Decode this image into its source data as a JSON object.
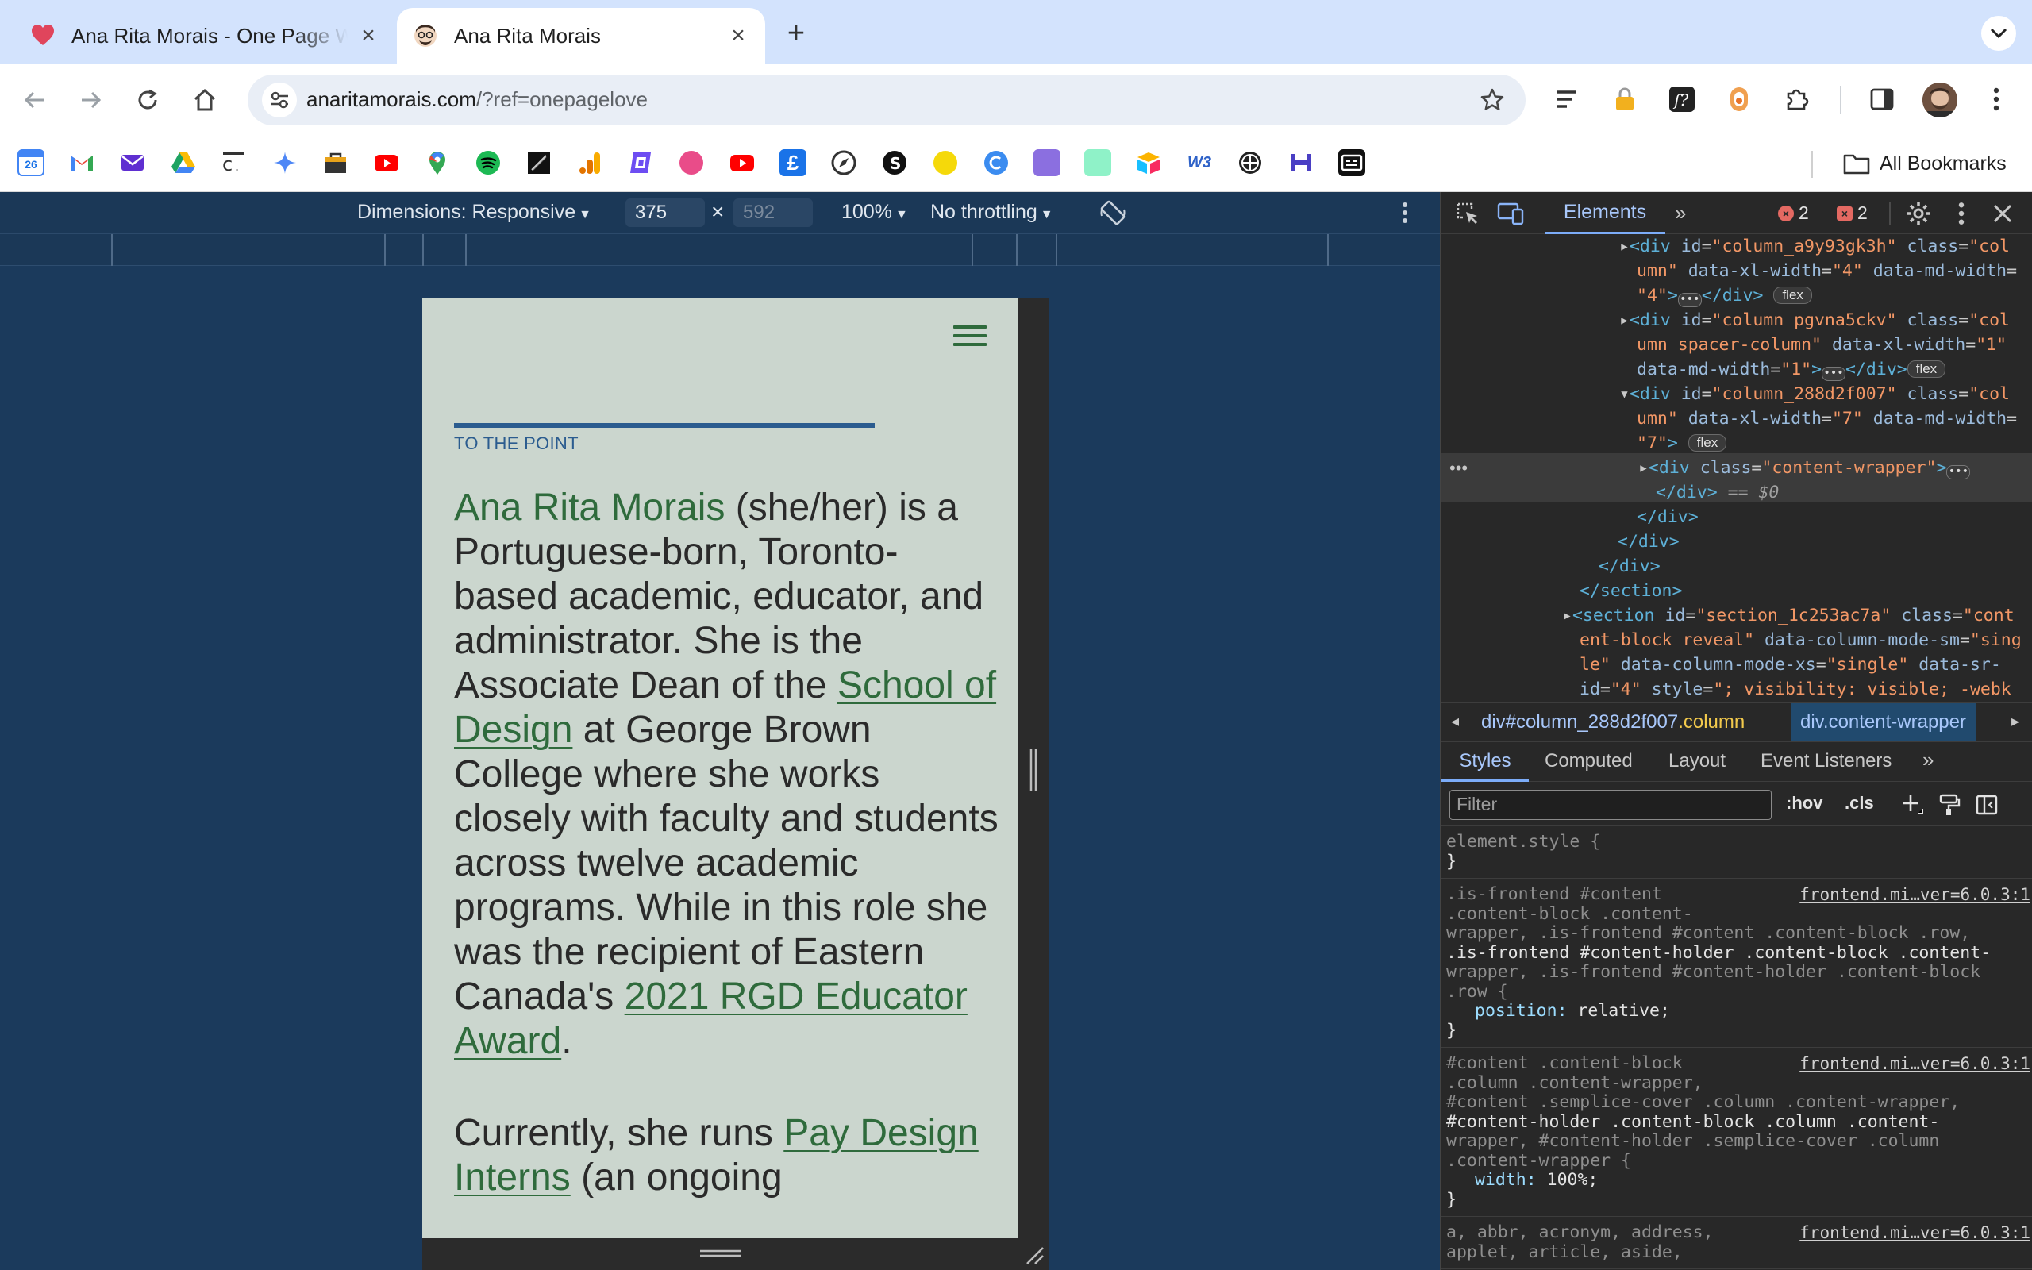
{
  "tabs": [
    {
      "title": "Ana Rita Morais - One Page Website",
      "active": false
    },
    {
      "title": "Ana Rita Morais",
      "active": true
    }
  ],
  "toolbar": {
    "url_host": "anaritamorais.com",
    "url_rest": "/?ref=onepagelove"
  },
  "bookmarks": {
    "calendar_day": "26",
    "all_label": "All Bookmarks"
  },
  "device_toolbar": {
    "dimensions_label": "Dimensions: Responsive",
    "width": "375",
    "height_placeholder": "592",
    "times": "×",
    "zoom": "100%",
    "throttling": "No throttling"
  },
  "page": {
    "eyebrow": "TO THE POINT",
    "name": "Ana Rita Morais",
    "p1_a": " (she/her) is a Portuguese-born, Toronto-based academic, educator, and administrator. She is the Associate Dean of the ",
    "link_school": "School of Design",
    "p1_b": " at George Brown College where she works closely with faculty and students across twelve academic programs. While in this role she was the recipient of Eastern Canada's ",
    "link_award": "2021 RGD Educator Award",
    "p1_c": ".",
    "p2_a": "Currently, she runs ",
    "link_pdi": "Pay Design Interns",
    "p2_b": " (an ongoing"
  },
  "devtools": {
    "elements_tab": "Elements",
    "errors": "2",
    "warnings": "2",
    "dom": {
      "col1_id": "column_a9y93gk3h",
      "col1_class": "column",
      "col1_xl": "4",
      "col1_md": "4",
      "col2_id": "column_pgvna5ckv",
      "col2_class": "column spacer-column",
      "col2_xl": "1",
      "col2_md": "1",
      "col3_id": "column_288d2f007",
      "col3_class": "column",
      "col3_xl": "7",
      "col3_md": "7",
      "cw_class": "content-wrapper",
      "eq": "== $0",
      "sec_id": "section_1c253ac7a",
      "sec_class": "content-block reveal",
      "sec_sm": "single",
      "sec_xs": "single",
      "sec_sr": "4",
      "sec_style": "; visibility: visible;  -webk",
      "flex": "flex"
    },
    "breadcrumb": {
      "item1_tag": "div",
      "item1_id": "#column_288d2f007",
      "item1_cls": ".column",
      "item2": "div.content-wrapper"
    },
    "subtabs": [
      "Styles",
      "Computed",
      "Layout",
      "Event Listeners"
    ],
    "filter_placeholder": "Filter",
    "hov": ":hov",
    "cls": ".cls",
    "rules": {
      "r1_selector": "element.style {",
      "close": "}",
      "src": "frontend.mi…ver=6.0.3:1",
      "r2_l1": ".is-frontend #content",
      "r2_l2": ".content-block .content-",
      "r2_l3": "wrapper, .is-frontend #content .content-block .row,",
      "r2_l4": ".is-frontend #content-holder .content-block .content-",
      "r2_l5": "wrapper, .is-frontend #content-holder .content-block",
      "r2_l6": ".row {",
      "r2_prop": "position",
      "r2_val": "relative;",
      "r3_l1": "#content .content-block",
      "r3_l2": ".column .content-wrapper,",
      "r3_l3": "#content .semplice-cover .column .content-wrapper,",
      "r3_l4": "#content-holder .content-block .column .content-",
      "r3_l5": "wrapper, #content-holder .semplice-cover .column",
      "r3_l6": ".content-wrapper {",
      "r3_prop": "width",
      "r3_val": "100%;",
      "r4_l1": "a, abbr, acronym, address,",
      "r4_l2": "applet, article, aside,"
    }
  }
}
